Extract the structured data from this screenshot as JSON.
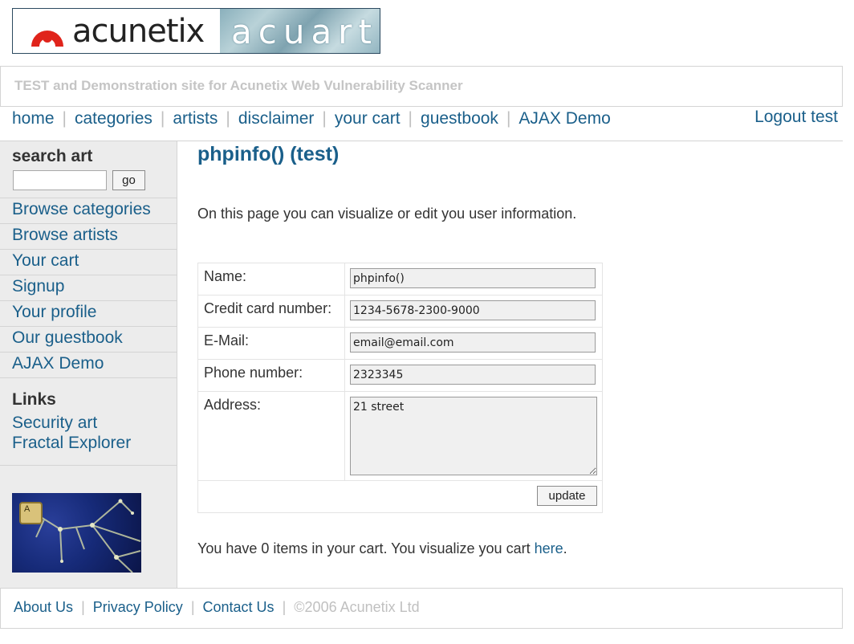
{
  "logo": {
    "acunetix_text": "acunetix",
    "acuart_text": "acuart",
    "brand_red": "#e0241b"
  },
  "tagline": "TEST and Demonstration site for Acunetix Web Vulnerability Scanner",
  "topnav": {
    "items": [
      "home",
      "categories",
      "artists",
      "disclaimer",
      "your cart",
      "guestbook",
      "AJAX Demo"
    ],
    "logout": "Logout test"
  },
  "sidebar": {
    "search_title": "search art",
    "search_value": "",
    "go_label": "go",
    "items": [
      "Browse categories",
      "Browse artists",
      "Your cart",
      "Signup",
      "Your profile",
      "Our guestbook",
      "AJAX Demo"
    ],
    "links_title": "Links",
    "links": [
      "Security art",
      "Fractal Explorer"
    ],
    "badge_letter": "A"
  },
  "main": {
    "title": "phpinfo() (test)",
    "intro": "On this page you can visualize or edit you user information.",
    "form": {
      "name_label": "Name:",
      "name_value": "phpinfo()",
      "cc_label": "Credit card number:",
      "cc_value": "1234-5678-2300-9000",
      "email_label": "E-Mail:",
      "email_value": "email@email.com",
      "phone_label": "Phone number:",
      "phone_value": "2323345",
      "address_label": "Address:",
      "address_value": "21 street",
      "update_label": "update"
    },
    "cart_note": "You have 0 items in your cart. You visualize you cart",
    "cart_link": "here",
    "cart_period": "."
  },
  "footer": {
    "about": "About Us",
    "privacy": "Privacy Policy",
    "contact": "Contact Us",
    "copyright": "©2006 Acunetix Ltd",
    "separator": "|"
  },
  "colors": {
    "link": "#1a5f8a",
    "sidebar_bg": "#ececec",
    "border": "#d4d4d4"
  }
}
